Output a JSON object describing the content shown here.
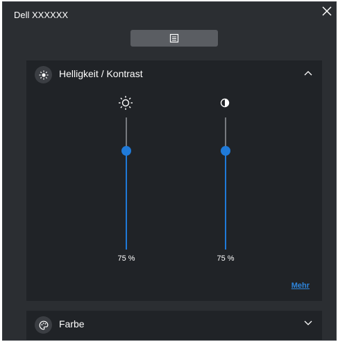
{
  "window": {
    "title": "Dell XXXXXX"
  },
  "toolbar": {
    "menu_icon": "document-list-icon"
  },
  "brightness_panel": {
    "title": "Helligkeit / Kontrast",
    "icon": "brightness-icon",
    "expanded": true,
    "sliders": [
      {
        "name": "brightness",
        "icon": "sun-icon",
        "value_percent": 75,
        "label": "75 %"
      },
      {
        "name": "contrast",
        "icon": "contrast-icon",
        "value_percent": 75,
        "label": "75 %"
      }
    ],
    "more_label": "Mehr"
  },
  "color_panel": {
    "title": "Farbe",
    "icon": "palette-icon",
    "expanded": false
  },
  "colors": {
    "background": "#2b2e32",
    "panel": "#202327",
    "accent": "#1f7ad9",
    "link": "#2e86de"
  }
}
